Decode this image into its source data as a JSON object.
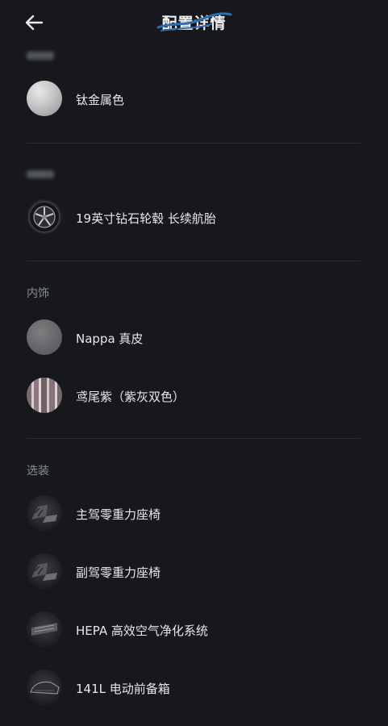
{
  "header": {
    "title": "配置详情"
  },
  "sections": {
    "interior": {
      "title": "内饰"
    },
    "options": {
      "title": "选装"
    }
  },
  "items": {
    "exterior_color": "钛金属色",
    "wheels": "19英寸钻石轮毂 长续航胎",
    "seat_material": "Nappa 真皮",
    "interior_color": "鸢尾紫（紫灰双色）",
    "driver_seat": "主驾零重力座椅",
    "passenger_seat": "副驾零重力座椅",
    "air_filter": "HEPA 高效空气净化系统",
    "front_trunk": "141L 电动前备箱"
  }
}
